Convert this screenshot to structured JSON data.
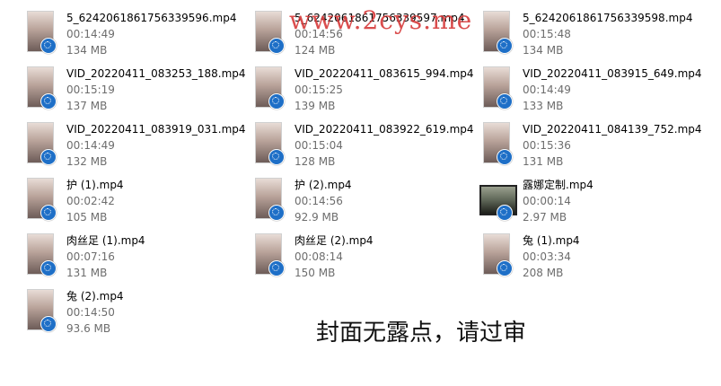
{
  "watermark": "www.2cys.me",
  "notice": "封面无露点，请过审",
  "files": [
    {
      "name": "5_6242061861756339596.mp4",
      "duration": "00:14:49",
      "size": "134 MB"
    },
    {
      "name": "5_6242061861756339597.mp4",
      "duration": "00:14:56",
      "size": "124 MB"
    },
    {
      "name": "5_6242061861756339598.mp4",
      "duration": "00:15:48",
      "size": "134 MB"
    },
    {
      "name": "VID_20220411_083253_188.mp4",
      "duration": "00:15:19",
      "size": "137 MB"
    },
    {
      "name": "VID_20220411_083615_994.mp4",
      "duration": "00:15:25",
      "size": "139 MB"
    },
    {
      "name": "VID_20220411_083915_649.mp4",
      "duration": "00:14:49",
      "size": "133 MB"
    },
    {
      "name": "VID_20220411_083919_031.mp4",
      "duration": "00:14:49",
      "size": "132 MB"
    },
    {
      "name": "VID_20220411_083922_619.mp4",
      "duration": "00:15:04",
      "size": "128 MB"
    },
    {
      "name": "VID_20220411_084139_752.mp4",
      "duration": "00:15:36",
      "size": "131 MB"
    },
    {
      "name": "护 (1).mp4",
      "duration": "00:02:42",
      "size": "105 MB"
    },
    {
      "name": "护 (2).mp4",
      "duration": "00:14:56",
      "size": "92.9 MB"
    },
    {
      "name": "露娜定制.mp4",
      "duration": "00:00:14",
      "size": "2.97 MB"
    },
    {
      "name": "肉丝足 (1).mp4",
      "duration": "00:07:16",
      "size": "131 MB"
    },
    {
      "name": "肉丝足 (2).mp4",
      "duration": "00:08:14",
      "size": "150 MB"
    },
    {
      "name": "兔 (1).mp4",
      "duration": "00:03:34",
      "size": "208 MB"
    },
    {
      "name": "兔 (2).mp4",
      "duration": "00:14:50",
      "size": "93.6 MB"
    }
  ]
}
